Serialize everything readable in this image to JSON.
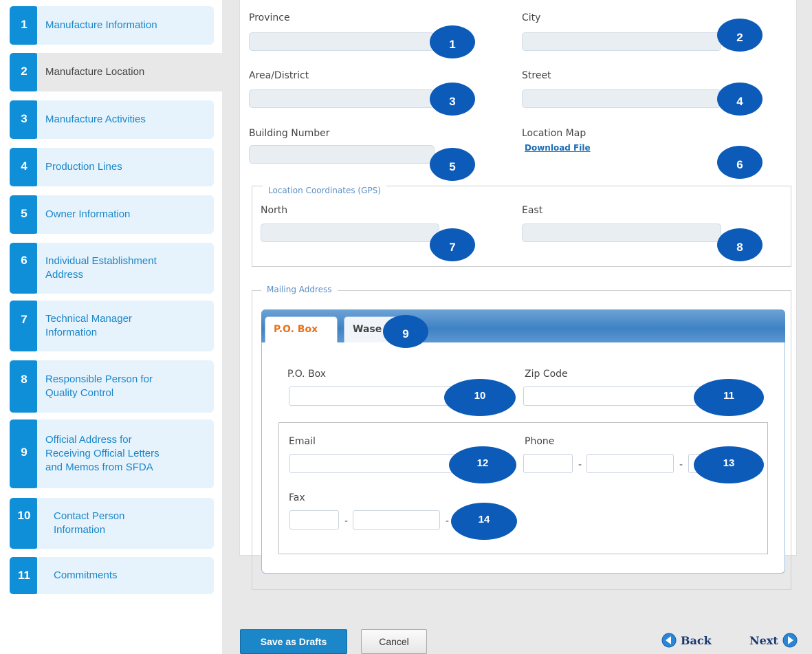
{
  "sidebar": {
    "steps": [
      {
        "number": "1",
        "label": "Manufacture Information"
      },
      {
        "number": "2",
        "label": "Manufacture Location"
      },
      {
        "number": "3",
        "label": "Manufacture Activities"
      },
      {
        "number": "4",
        "label": "Production Lines"
      },
      {
        "number": "5",
        "label": "Owner Information"
      },
      {
        "number": "6",
        "label": "Individual Establishment\nAddress"
      },
      {
        "number": "7",
        "label": "Technical Manager\nInformation"
      },
      {
        "number": "8",
        "label": "Responsible Person for\nQuality Control"
      },
      {
        "number": "9",
        "label": "Official Address for\nReceiving Official Letters\nand Memos from SFDA"
      },
      {
        "number": "10",
        "label": "Contact Person\nInformation"
      },
      {
        "number": "11",
        "label": "Commitments"
      }
    ],
    "active_step": "2"
  },
  "form": {
    "province_label": "Province",
    "city_label": "City",
    "area_label": "Area/District",
    "street_label": "Street",
    "building_label": "Building Number",
    "location_map_label": "Location Map",
    "download_link": "Download File",
    "gps": {
      "legend": "Location Coordinates (GPS)",
      "north_label": "North",
      "east_label": "East"
    },
    "mailing": {
      "legend": "Mailing Address",
      "tab_pobox": "P.O. Box",
      "tab_wasel": "Wase",
      "pobox_label": "P.O. Box",
      "zip_label": "Zip Code",
      "email_label": "Email",
      "phone_label": "Phone",
      "fax_label": "Fax",
      "separator": "-"
    }
  },
  "markers": [
    "1",
    "2",
    "3",
    "4",
    "5",
    "6",
    "7",
    "8",
    "9",
    "10",
    "11",
    "12",
    "13",
    "14"
  ],
  "actions": {
    "save_drafts": "Save as Drafts",
    "cancel": "Cancel",
    "back": "Back",
    "next": "Next"
  }
}
